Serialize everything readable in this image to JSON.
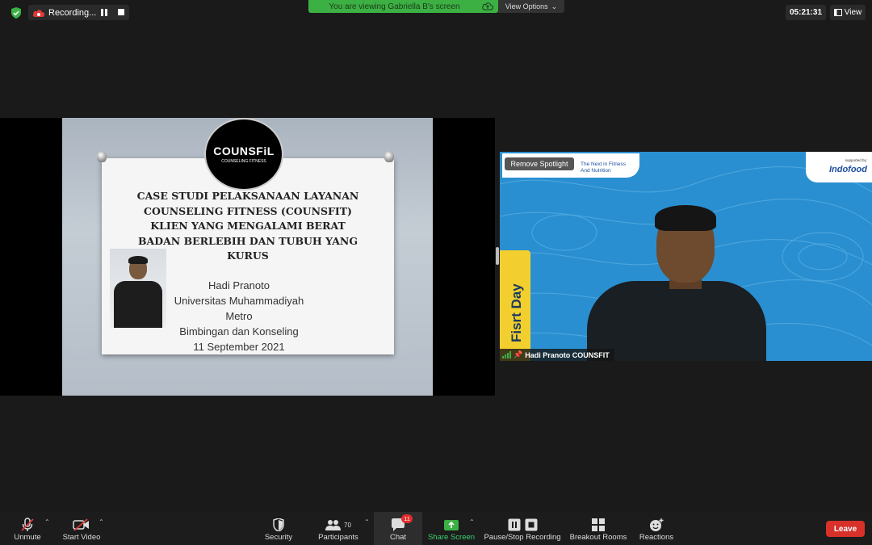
{
  "topbar": {
    "recording_label": "Recording...",
    "banner_text": "You are viewing Gabriella B's screen",
    "view_options_label": "View Options",
    "clock": "05:21:31",
    "view_label": "View"
  },
  "slide": {
    "logo_text": "COUNSFiL",
    "logo_subtext": "COUNSELING FITNESS",
    "title_lines": [
      "CASE STUDI PELAKSANAAN LAYANAN",
      "COUNSELING FITNESS (COUNSFIT)",
      "KLIEN YANG MENGALAMI BERAT",
      "BADAN BERLEBIH DAN TUBUH YANG",
      "KURUS"
    ],
    "author_lines": [
      "Hadi Pranoto",
      "Universitas Muhammadiyah Metro",
      "Bimbingan dan Konseling",
      "11 September 2021"
    ]
  },
  "video": {
    "remove_spotlight_label": "Remove Spotlight",
    "event_tagline_1": "The Next in Fitness",
    "event_tagline_2": "And Nutrition",
    "supported_by": "supported by:",
    "sponsor": "Indofood",
    "side_banner_text": "Fisrt Day",
    "participant_name": "Hadi Pranoto COUNSFIT"
  },
  "toolbar": {
    "unmute": "Unmute",
    "start_video": "Start Video",
    "security": "Security",
    "participants": "Participants",
    "participants_count": "70",
    "chat": "Chat",
    "chat_badge": "11",
    "share_screen": "Share Screen",
    "pause_stop_recording": "Pause/Stop Recording",
    "breakout_rooms": "Breakout Rooms",
    "reactions": "Reactions",
    "leave": "Leave"
  },
  "colors": {
    "share_green": "#3cb043",
    "leave_red": "#d7312a",
    "video_blue": "#2a8fd0",
    "banner_yellow": "#f2cf2e"
  }
}
